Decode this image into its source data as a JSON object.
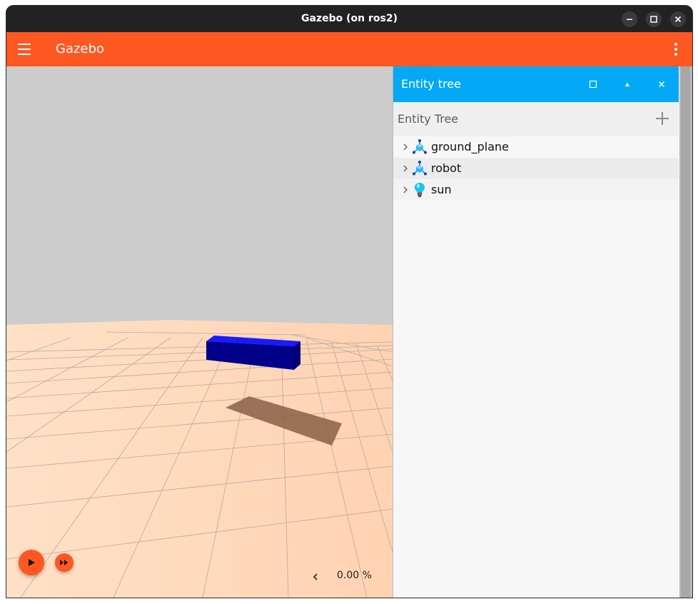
{
  "window": {
    "title": "Gazebo (on ros2)",
    "controls": [
      "minimize",
      "maximize",
      "close"
    ]
  },
  "appbar": {
    "title": "Gazebo"
  },
  "panel": {
    "title": "Entity tree",
    "header_label": "Entity Tree",
    "entities": [
      {
        "name": "ground_plane",
        "icon": "model-icon"
      },
      {
        "name": "robot",
        "icon": "model-icon"
      },
      {
        "name": "sun",
        "icon": "light-icon"
      }
    ]
  },
  "playback": {
    "rtf": "0.00 %"
  },
  "colors": {
    "appbar": "#ff5722",
    "panel_titlebar": "#03a9f4",
    "sky": "#cccccc",
    "ground": "#ffdcc0",
    "box": "#0000a0"
  }
}
